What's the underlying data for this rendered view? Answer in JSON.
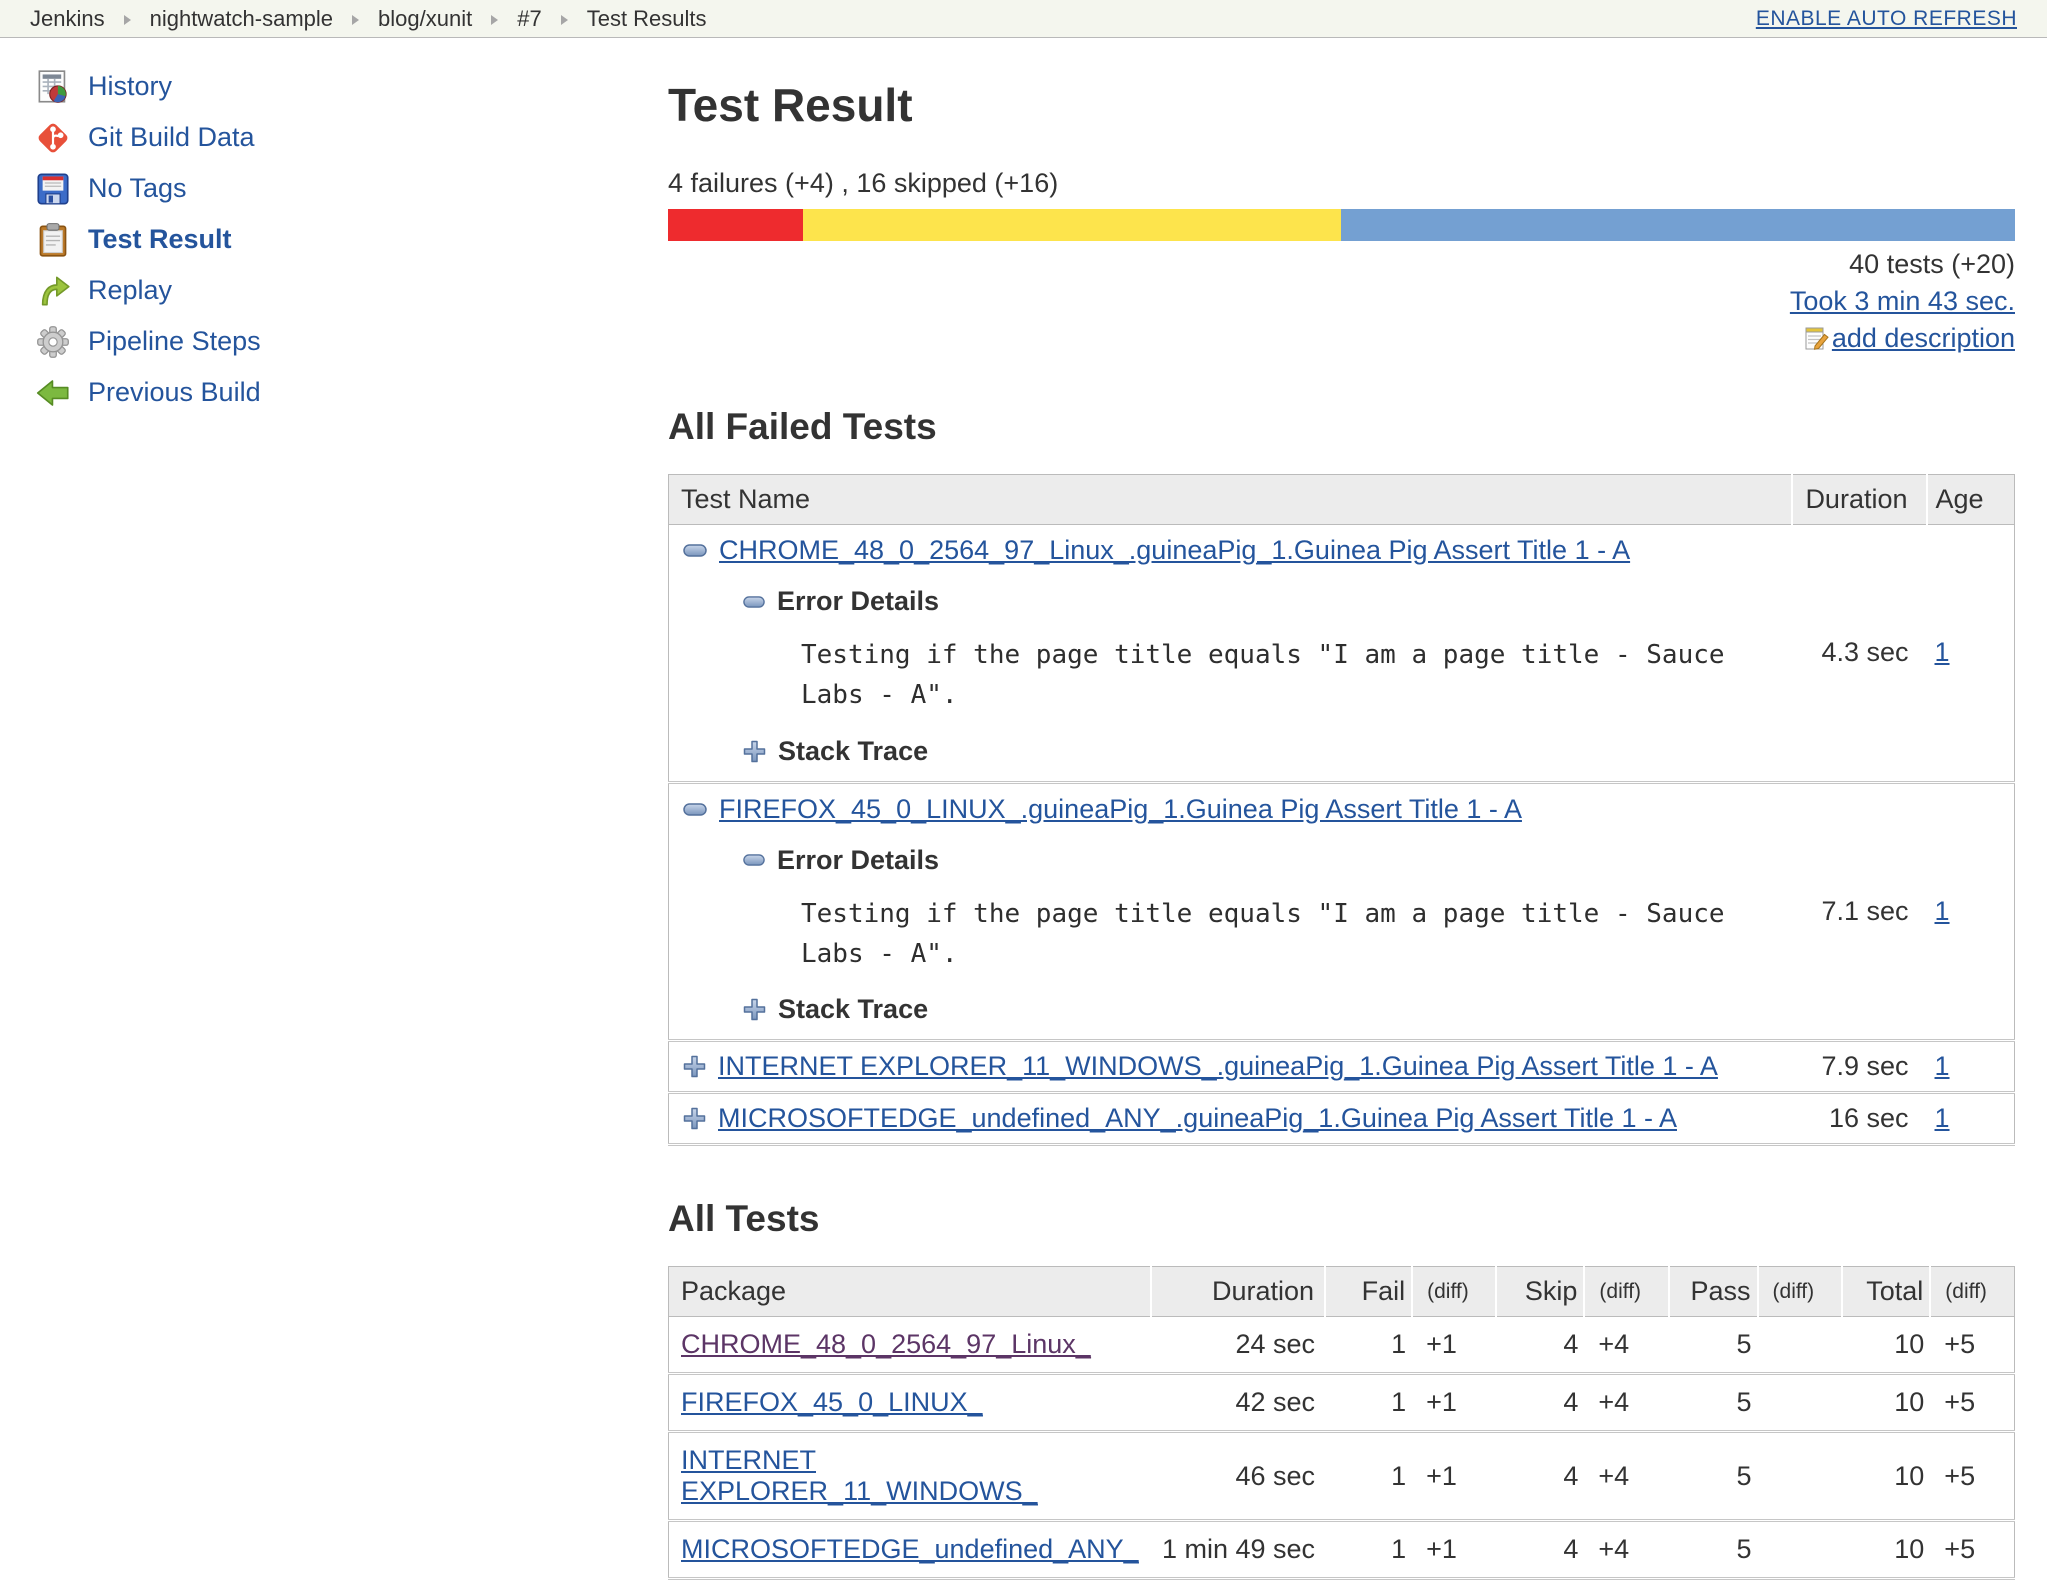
{
  "colors": {
    "link_blue": "#24549c",
    "link_visited": "#5c3566"
  },
  "breadcrumb": {
    "items": [
      "Jenkins",
      "nightwatch-sample",
      "blog/xunit",
      "#7",
      "Test Results"
    ],
    "auto_refresh_label": "ENABLE AUTO REFRESH"
  },
  "sidebar": {
    "items": [
      {
        "label": "History",
        "icon": "history-icon"
      },
      {
        "label": "Git Build Data",
        "icon": "git-icon"
      },
      {
        "label": "No Tags",
        "icon": "floppy-icon"
      },
      {
        "label": "Test Result",
        "icon": "clipboard-icon",
        "active": true
      },
      {
        "label": "Replay",
        "icon": "replay-icon"
      },
      {
        "label": "Pipeline Steps",
        "icon": "gear-icon"
      },
      {
        "label": "Previous Build",
        "icon": "arrow-left-icon"
      }
    ]
  },
  "summary": {
    "title": "Test Result",
    "failures_line": "4 failures (+4) , 16 skipped (+16)",
    "tests_total": "40 tests (+20)",
    "took_label": "Took 3 min 43 sec.",
    "add_description_label": "add description",
    "bar": {
      "fail_pct": 10,
      "skip_pct": 40,
      "pass_pct": 50,
      "fail_color": "#ee2b2e",
      "skip_color": "#fde44c",
      "pass_color": "#74a0d2"
    }
  },
  "failed_tests": {
    "heading": "All Failed Tests",
    "columns": {
      "name": "Test Name",
      "duration": "Duration",
      "age": "Age"
    },
    "error_details_label": "Error Details",
    "stack_trace_label": "Stack Trace",
    "rows": [
      {
        "name": "CHROME_48_0_2564_97_Linux_.guineaPig_1.Guinea Pig Assert Title 1 - A",
        "duration": "4.3 sec",
        "age": "1",
        "expanded": true,
        "error_text": "Testing if the page title equals \"I am a page title - Sauce Labs - A\"."
      },
      {
        "name": "FIREFOX_45_0_LINUX_.guineaPig_1.Guinea Pig Assert Title 1 - A",
        "duration": "7.1 sec",
        "age": "1",
        "expanded": true,
        "error_text": "Testing if the page title equals \"I am a page title - Sauce Labs - A\"."
      },
      {
        "name": "INTERNET EXPLORER_11_WINDOWS_.guineaPig_1.Guinea Pig Assert Title 1 - A",
        "duration": "7.9 sec",
        "age": "1",
        "expanded": false
      },
      {
        "name": "MICROSOFTEDGE_undefined_ANY_.guineaPig_1.Guinea Pig Assert Title 1 - A",
        "duration": "16 sec",
        "age": "1",
        "expanded": false
      }
    ]
  },
  "all_tests": {
    "heading": "All Tests",
    "columns": [
      "Package",
      "Duration",
      "Fail",
      "(diff)",
      "Skip",
      "(diff)",
      "Pass",
      "(diff)",
      "Total",
      "(diff)"
    ],
    "rows": [
      {
        "package": "CHROME_48_0_2564_97_Linux_",
        "duration": "24 sec",
        "fail": "1",
        "fail_diff": "+1",
        "skip": "4",
        "skip_diff": "+4",
        "pass": "5",
        "pass_diff": "",
        "total": "10",
        "total_diff": "+5",
        "visited": true
      },
      {
        "package": "FIREFOX_45_0_LINUX_",
        "duration": "42 sec",
        "fail": "1",
        "fail_diff": "+1",
        "skip": "4",
        "skip_diff": "+4",
        "pass": "5",
        "pass_diff": "",
        "total": "10",
        "total_diff": "+5",
        "visited": false
      },
      {
        "package": "INTERNET EXPLORER_11_WINDOWS_",
        "duration": "46 sec",
        "fail": "1",
        "fail_diff": "+1",
        "skip": "4",
        "skip_diff": "+4",
        "pass": "5",
        "pass_diff": "",
        "total": "10",
        "total_diff": "+5",
        "visited": false
      },
      {
        "package": "MICROSOFTEDGE_undefined_ANY_",
        "duration": "1 min 49 sec",
        "fail": "1",
        "fail_diff": "+1",
        "skip": "4",
        "skip_diff": "+4",
        "pass": "5",
        "pass_diff": "",
        "total": "10",
        "total_diff": "+5",
        "visited": false
      }
    ]
  }
}
